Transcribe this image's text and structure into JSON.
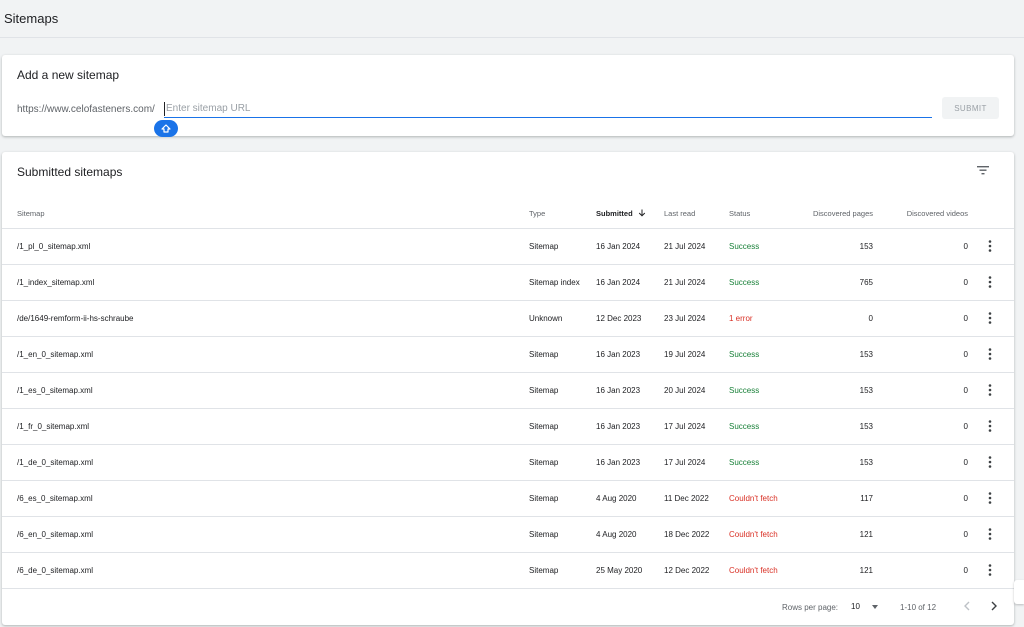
{
  "page": {
    "title": "Sitemaps"
  },
  "add_sitemap": {
    "title": "Add a new sitemap",
    "url_prefix": "https://www.celofasteners.com/",
    "placeholder": "Enter sitemap URL",
    "value": "",
    "submit_label": "SUBMIT"
  },
  "submitted": {
    "title": "Submitted sitemaps",
    "columns": {
      "sitemap": "Sitemap",
      "type": "Type",
      "submitted": "Submitted",
      "last_read": "Last read",
      "status": "Status",
      "discovered_pages": "Discovered pages",
      "discovered_videos": "Discovered videos"
    },
    "rows": [
      {
        "sitemap": "/1_pl_0_sitemap.xml",
        "type": "Sitemap",
        "submitted": "16 Jan 2024",
        "last_read": "21 Jul 2024",
        "status": "Success",
        "pages": "153",
        "videos": "0"
      },
      {
        "sitemap": "/1_index_sitemap.xml",
        "type": "Sitemap index",
        "submitted": "16 Jan 2024",
        "last_read": "21 Jul 2024",
        "status": "Success",
        "pages": "765",
        "videos": "0"
      },
      {
        "sitemap": "/de/1649-remform-ii-hs-schraube",
        "type": "Unknown",
        "submitted": "12 Dec 2023",
        "last_read": "23 Jul 2024",
        "status": "1 error",
        "pages": "0",
        "videos": "0"
      },
      {
        "sitemap": "/1_en_0_sitemap.xml",
        "type": "Sitemap",
        "submitted": "16 Jan 2023",
        "last_read": "19 Jul 2024",
        "status": "Success",
        "pages": "153",
        "videos": "0"
      },
      {
        "sitemap": "/1_es_0_sitemap.xml",
        "type": "Sitemap",
        "submitted": "16 Jan 2023",
        "last_read": "20 Jul 2024",
        "status": "Success",
        "pages": "153",
        "videos": "0"
      },
      {
        "sitemap": "/1_fr_0_sitemap.xml",
        "type": "Sitemap",
        "submitted": "16 Jan 2023",
        "last_read": "17 Jul 2024",
        "status": "Success",
        "pages": "153",
        "videos": "0"
      },
      {
        "sitemap": "/1_de_0_sitemap.xml",
        "type": "Sitemap",
        "submitted": "16 Jan 2023",
        "last_read": "17 Jul 2024",
        "status": "Success",
        "pages": "153",
        "videos": "0"
      },
      {
        "sitemap": "/6_es_0_sitemap.xml",
        "type": "Sitemap",
        "submitted": "4 Aug 2020",
        "last_read": "11 Dec 2022",
        "status": "Couldn't fetch",
        "pages": "117",
        "videos": "0"
      },
      {
        "sitemap": "/6_en_0_sitemap.xml",
        "type": "Sitemap",
        "submitted": "4 Aug 2020",
        "last_read": "18 Dec 2022",
        "status": "Couldn't fetch",
        "pages": "121",
        "videos": "0"
      },
      {
        "sitemap": "/6_de_0_sitemap.xml",
        "type": "Sitemap",
        "submitted": "25 May 2020",
        "last_read": "12 Dec 2022",
        "status": "Couldn't fetch",
        "pages": "121",
        "videos": "0"
      }
    ]
  },
  "pagination": {
    "rows_per_page_label": "Rows per page:",
    "rows_per_page": "10",
    "range": "1-10 of 12"
  },
  "icons": {
    "filter": "filter-icon",
    "sort": "arrow-down-icon",
    "more": "more-vert-icon",
    "prev": "chevron-left-icon",
    "next": "chevron-right-icon",
    "dropdown": "dropdown-arrow-icon",
    "cursor_handle": "text-cursor-handle-icon"
  },
  "colors": {
    "accent": "#1a73e8",
    "success": "#188038",
    "error": "#d93025"
  }
}
